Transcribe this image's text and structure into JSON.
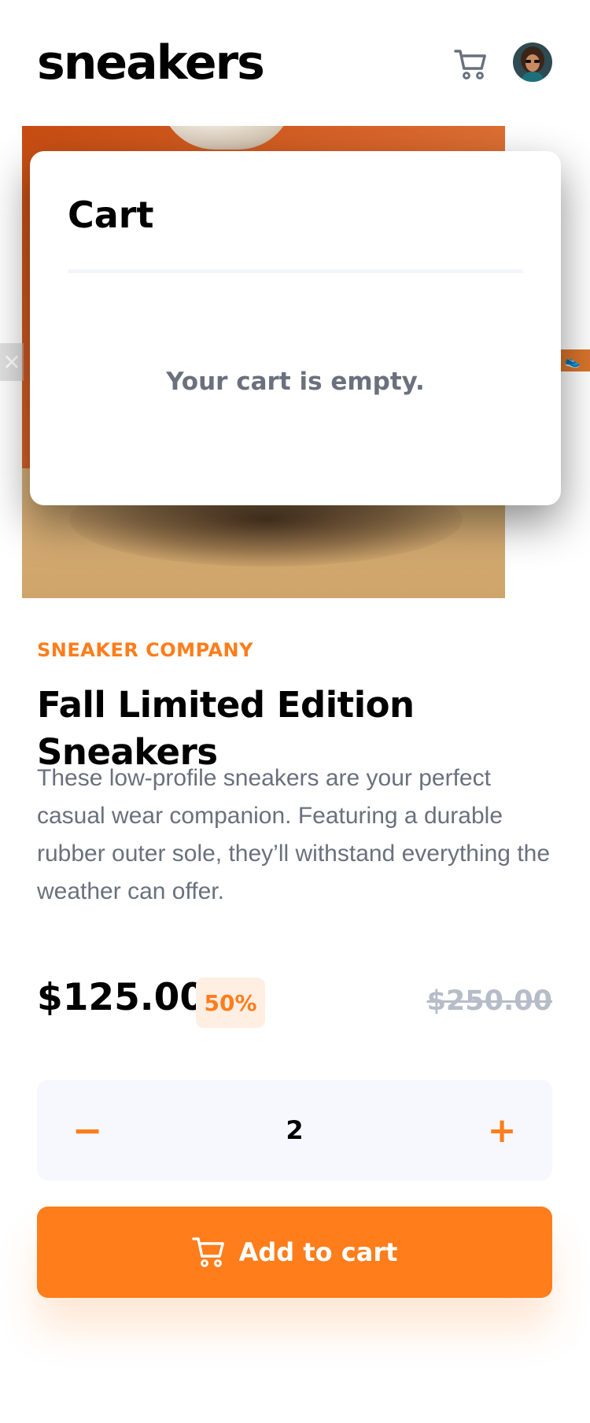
{
  "header": {
    "logo": "sneakers",
    "cart_icon": "cart-icon",
    "avatar_alt": "user avatar"
  },
  "gallery": {
    "prev_icon": "close-icon",
    "next_thumb_icon": "shoe-thumbnail-icon"
  },
  "cart": {
    "title": "Cart",
    "empty_message": "Your cart is empty."
  },
  "product": {
    "brand": "SNEAKER COMPANY",
    "title": "Fall Limited Edition Sneakers",
    "description": "These low-profile sneakers are your perfect casual wear companion. Featuring a durable rubber outer sole, they’ll withstand everything the weather can offer.",
    "price": "$125.00",
    "discount": "50%",
    "original_price": "$250.00"
  },
  "quantity": {
    "minus_label": "−",
    "value": "2",
    "plus_label": "+"
  },
  "actions": {
    "add_to_cart_label": "Add to cart"
  },
  "colors": {
    "accent": "#ff7d1b",
    "accent_light": "#ffeee2",
    "text_dark": "#000000",
    "text_muted": "#6a707d",
    "strike_gray": "#b6bcc8",
    "qty_bg": "#f6f8fd"
  }
}
